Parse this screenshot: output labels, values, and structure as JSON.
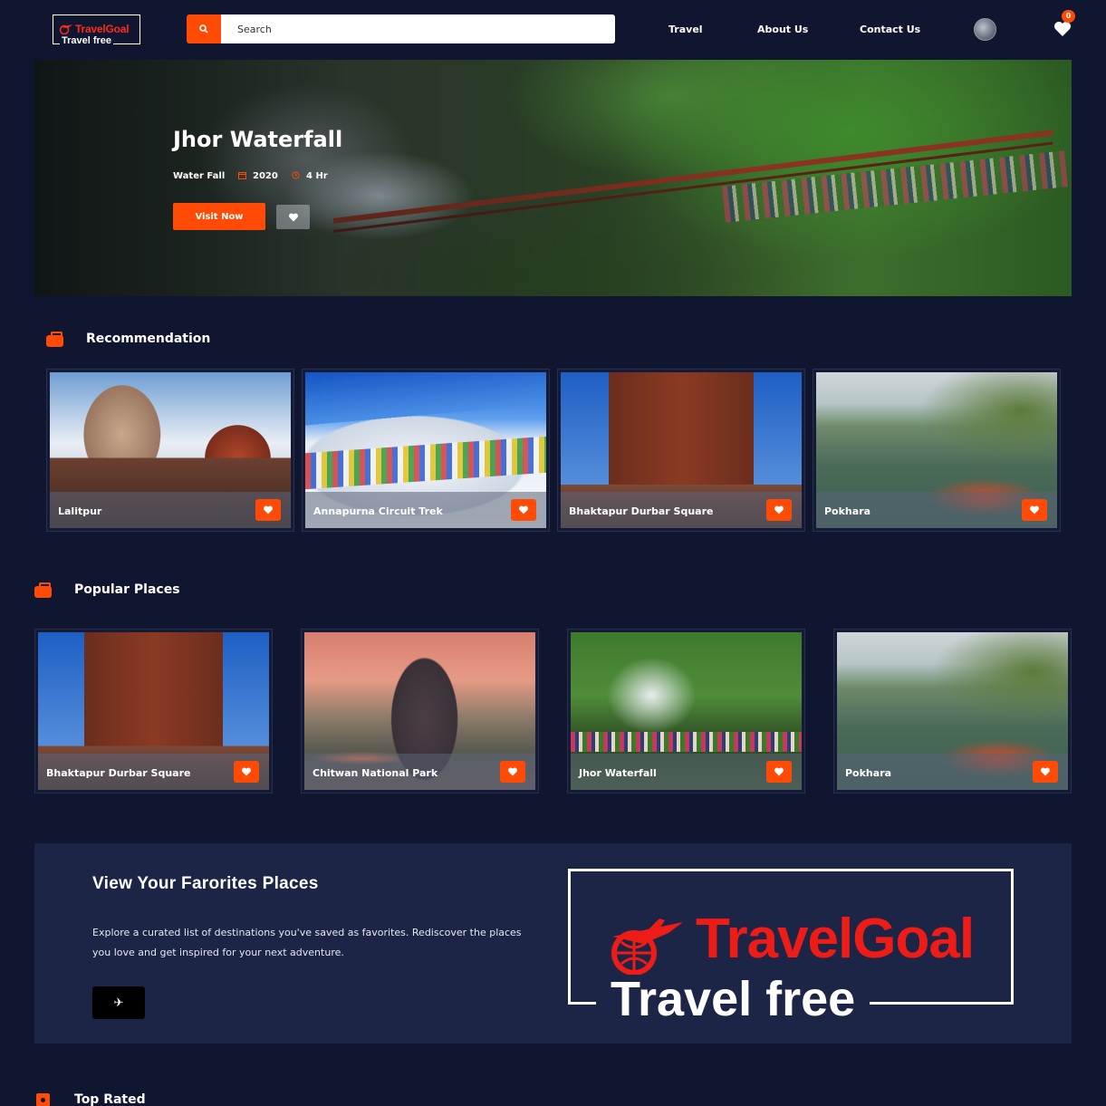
{
  "header": {
    "logo_line1": "TravelGoal",
    "logo_line2": "Travel free",
    "search_placeholder": "Search",
    "nav": [
      "Travel",
      "About Us",
      "Contact Us"
    ],
    "favorites_count": "0"
  },
  "hero": {
    "title": "Jhor Waterfall",
    "category": "Water Fall",
    "year": "2020",
    "duration": "4 Hr",
    "visit_label": "Visit Now"
  },
  "recommendation": {
    "title": "Recommendation",
    "items": [
      {
        "name": "Lalitpur",
        "scene": "temple"
      },
      {
        "name": "Annapurna Circuit Trek",
        "scene": "snow"
      },
      {
        "name": "Bhaktapur Durbar Square",
        "scene": "pagoda"
      },
      {
        "name": "Pokhara",
        "scene": "lake"
      }
    ]
  },
  "popular": {
    "title": "Popular Places",
    "items": [
      {
        "name": "Bhaktapur Durbar Square",
        "scene": "pagoda"
      },
      {
        "name": "Chitwan National Park",
        "scene": "elephant"
      },
      {
        "name": "Jhor Waterfall",
        "scene": "waterfall"
      },
      {
        "name": "Pokhara",
        "scene": "lake"
      }
    ]
  },
  "favorites_banner": {
    "title": "View Your Farorites Places",
    "description": "Explore a curated list of destinations you've saved as favorites. Rediscover the places you love and get inspired for your next adventure.",
    "button_icon": "airplane-icon",
    "logo_line1": "TravelGoal",
    "logo_line2": "Travel free"
  },
  "top_rated": {
    "title": "Top Rated"
  },
  "colors": {
    "background": "#10162f",
    "accent": "#ff4b05",
    "logo_red": "#ee1c16",
    "banner": "#1c2546"
  }
}
